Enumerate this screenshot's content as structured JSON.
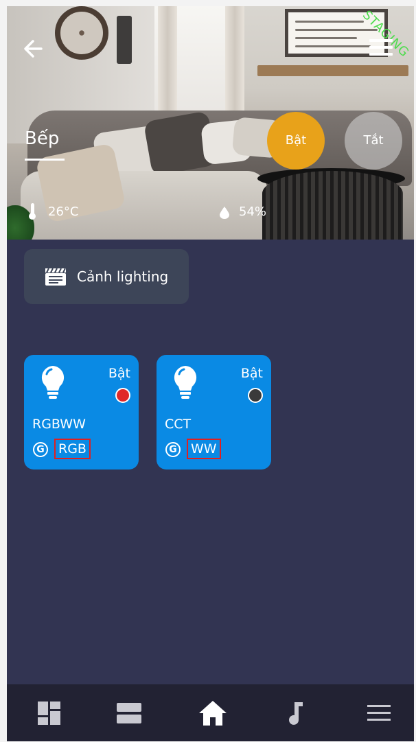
{
  "header": {
    "staging_label": "STAGING",
    "room_title": "Bếp",
    "power_on_label": "Bật",
    "power_off_label": "Tắt",
    "temperature": "26°C",
    "humidity": "54%"
  },
  "scene": {
    "label": "Cảnh lighting"
  },
  "devices": [
    {
      "name": "RGBWW",
      "state": "Bật",
      "mode": "RGB",
      "group_icon": "G",
      "dot_color": "#e02828"
    },
    {
      "name": "CCT",
      "state": "Bật",
      "mode": "WW",
      "group_icon": "G",
      "dot_color": "#3a3a3a"
    }
  ],
  "colors": {
    "app_bg": "#323452",
    "card_bg": "#0a8ae4",
    "on_button": "#e8a21a",
    "nav_bg": "#222233",
    "staging": "#4ddc4d",
    "highlight_box": "#e02020"
  },
  "bottom_nav": {
    "items": [
      "dashboard-icon",
      "rooms-icon",
      "home-icon",
      "music-icon",
      "menu-icon"
    ],
    "active": "home-icon"
  }
}
